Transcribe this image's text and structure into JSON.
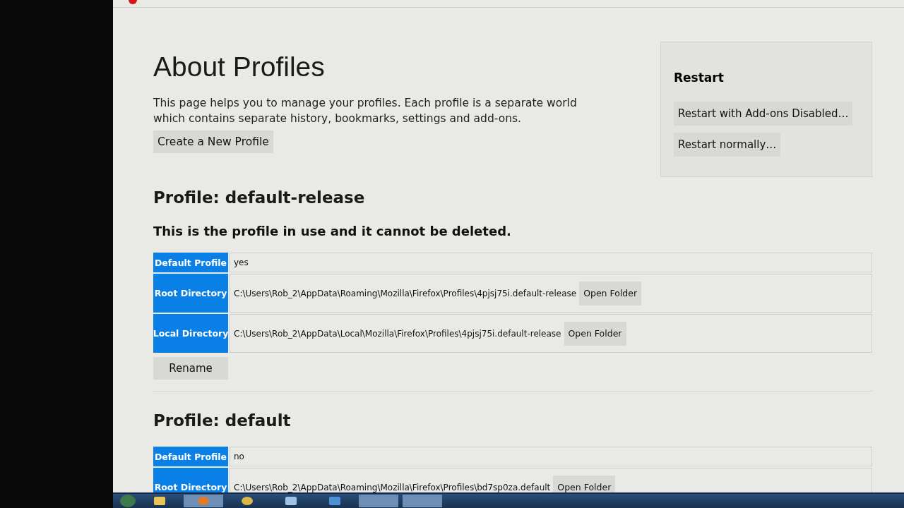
{
  "page": {
    "title": "About Profiles",
    "intro": "This page helps you to manage your profiles. Each profile is a separate world which contains separate history, bookmarks, settings and add-ons.",
    "create_button": "Create a New Profile"
  },
  "restart": {
    "title": "Restart",
    "buttons": [
      "Restart with Add-ons Disabled…",
      "Restart normally…"
    ]
  },
  "profiles": [
    {
      "heading": "Profile: default-release",
      "notice": "This is the profile in use and it cannot be deleted.",
      "rows": [
        {
          "label": "Default Profile",
          "value": "yes"
        },
        {
          "label": "Root Directory",
          "value": "C:\\Users\\Rob_2\\AppData\\Roaming\\Mozilla\\Firefox\\Profiles\\4pjsj75i.default-release",
          "button": "Open Folder"
        },
        {
          "label": "Local Directory",
          "value": "C:\\Users\\Rob_2\\AppData\\Local\\Mozilla\\Firefox\\Profiles\\4pjsj75i.default-release",
          "button": "Open Folder"
        }
      ],
      "actions": [
        "Rename"
      ]
    },
    {
      "heading": "Profile: default",
      "rows": [
        {
          "label": "Default Profile",
          "value": "no"
        },
        {
          "label": "Root Directory",
          "value": "C:\\Users\\Rob_2\\AppData\\Roaming\\Mozilla\\Firefox\\Profiles\\bd7sp0za.default",
          "button": "Open Folder"
        }
      ]
    }
  ]
}
